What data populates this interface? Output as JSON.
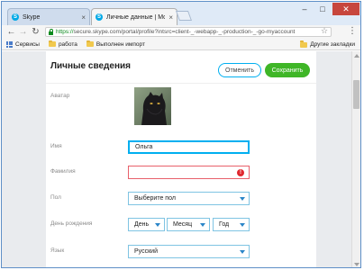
{
  "browser": {
    "tabs": [
      {
        "title": "Skype",
        "active": false
      },
      {
        "title": "Личные данные | Моя ...",
        "active": true
      }
    ],
    "window_controls": {
      "minimize": "–",
      "maximize": "□",
      "close": "✕"
    },
    "url": {
      "scheme": "https://",
      "rest": "secure.skype.com/portal/profile?intsrc=client-_-webapp-_-production-_-go-myaccount"
    },
    "bookmarks": [
      {
        "label": "Сервисы",
        "icon": "apps-grid-icon"
      },
      {
        "label": "работа",
        "icon": "folder-icon"
      },
      {
        "label": "Выполнен импорт",
        "icon": "folder-icon"
      }
    ],
    "other_bookmarks": "Другие закладки"
  },
  "page": {
    "title": "Личные сведения",
    "cancel_label": "Отменить",
    "save_label": "Сохранить",
    "colors": {
      "accent": "#00aff0",
      "save": "#3fb627",
      "error": "#e0282f",
      "caret": "#2a85c8"
    }
  },
  "form": {
    "avatar_label": "Аватар",
    "first_name_label": "Имя",
    "first_name_value": "Ольга",
    "last_name_label": "Фамилия",
    "last_name_value": "",
    "last_name_error_icon": "!",
    "gender_label": "Пол",
    "gender_value": "Выберите пол",
    "birthday_label": "День рождения",
    "day_value": "День",
    "month_value": "Месяц",
    "year_value": "Год",
    "language_label": "Язык",
    "language_value": "Русский"
  }
}
